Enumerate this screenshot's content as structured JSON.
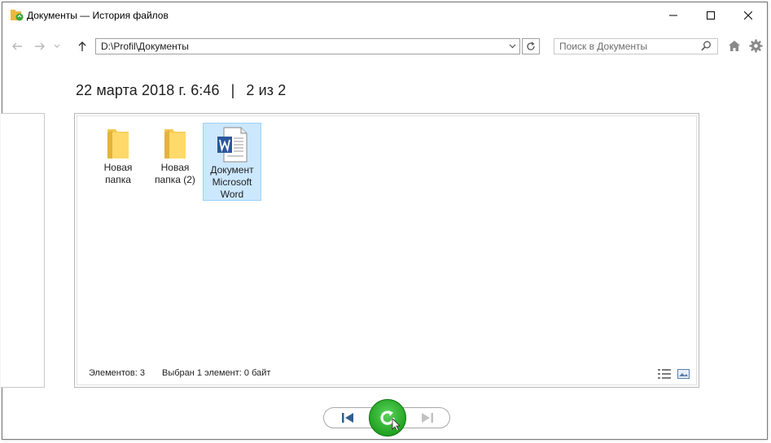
{
  "window": {
    "title": "Документы — История файлов",
    "controls": {
      "minimize": "minimize",
      "maximize": "maximize",
      "close": "close"
    }
  },
  "nav": {
    "address": "D:\\Profil\\Документы",
    "search_placeholder": "Поиск в Документы"
  },
  "snapshot": {
    "date": "22 марта 2018 г. 6:46",
    "separator": "|",
    "position": "2 из 2"
  },
  "items": [
    {
      "label_line1": "Новая",
      "label_line2": "папка",
      "label_line3": "",
      "icon": "folder-icon",
      "selected": false
    },
    {
      "label_line1": "Новая",
      "label_line2": "папка (2)",
      "label_line3": "",
      "icon": "folder-icon",
      "selected": false
    },
    {
      "label_line1": "Документ",
      "label_line2": "Microsoft",
      "label_line3": "Word",
      "icon": "word-document-icon",
      "selected": true
    }
  ],
  "status": {
    "count": "Элементов: 3",
    "selection": "Выбран 1 элемент: 0 байт"
  },
  "colors": {
    "selection_bg": "#cce8ff",
    "selection_border": "#99d1ff",
    "restore_green": "#22a322",
    "folder_yellow": "#f5c84c",
    "word_blue": "#2b579a"
  }
}
